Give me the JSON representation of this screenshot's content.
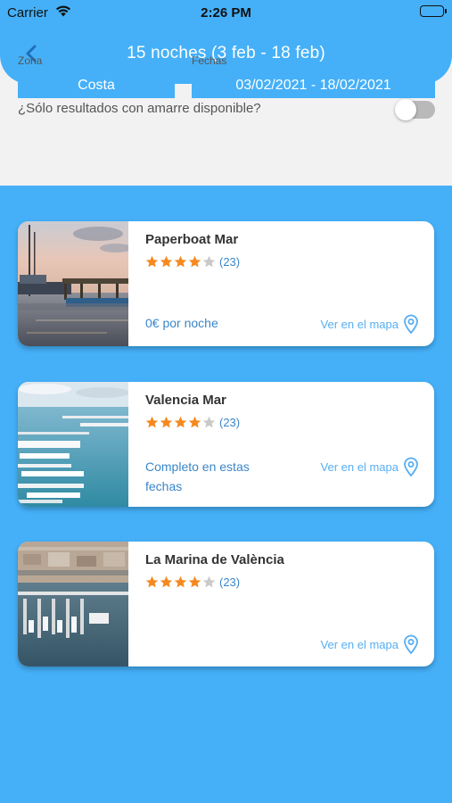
{
  "status_bar": {
    "carrier": "Carrier",
    "time": "2:26 PM"
  },
  "header": {
    "title": "15 noches (3 feb - 18 feb)",
    "back_icon": "chevron-left-icon"
  },
  "filters": {
    "zona_label": "Zona",
    "zona_value": "Costa",
    "fechas_label": "Fechas",
    "fechas_value": "03/02/2021 - 18/02/2021",
    "amarre_label": "¿Sólo resultados con amarre disponible?",
    "amarre_enabled": false
  },
  "colors": {
    "primary": "#45b0f8",
    "panel": "#f2f2f2",
    "star_on": "#f5891f",
    "star_off": "#c9c9c9",
    "link": "#57aef2",
    "price": "#3a86c8"
  },
  "results": [
    {
      "name": "Paperboat Mar",
      "rating": 4,
      "max_rating": 5,
      "rating_count": "(23)",
      "price_text": "0€ por noche",
      "map_link": "Ver en el mapa"
    },
    {
      "name": "Valencia Mar",
      "rating": 4,
      "max_rating": 5,
      "rating_count": "(23)",
      "price_text": "Completo en estas fechas",
      "map_link": "Ver en el mapa"
    },
    {
      "name": "La Marina de València",
      "rating": 4,
      "max_rating": 5,
      "rating_count": "(23)",
      "price_text": "",
      "map_link": "Ver en el mapa"
    }
  ]
}
